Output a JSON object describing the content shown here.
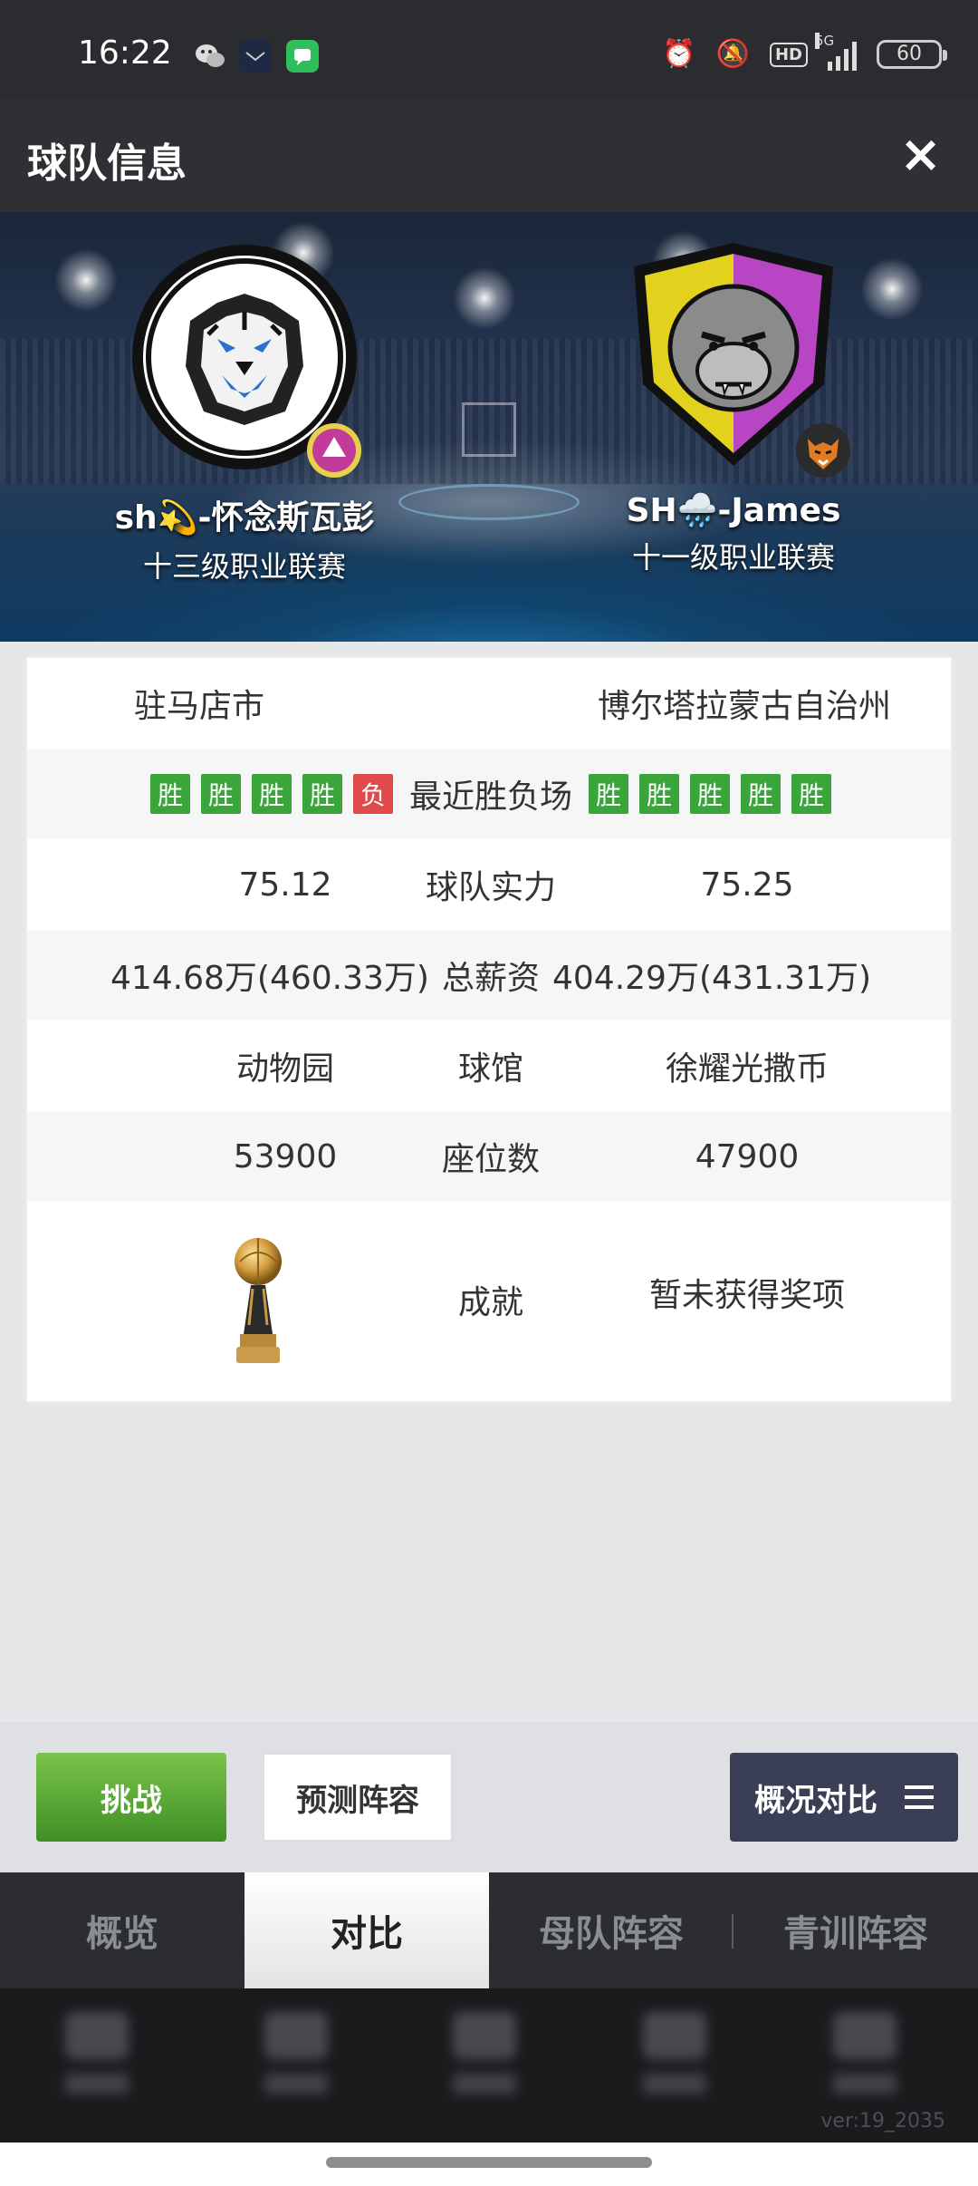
{
  "status_bar": {
    "time": "16:22",
    "network": "5G",
    "hd": "HD",
    "battery": "60"
  },
  "header": {
    "title": "球队信息",
    "close_icon": "×"
  },
  "home_team": {
    "name": "sh💫-怀念斯瓦彭",
    "league": "十三级职业联赛",
    "city": "驻马店市",
    "recent": [
      "胜",
      "胜",
      "胜",
      "胜",
      "负"
    ],
    "strength": "75.12",
    "salary": "414.68万(460.33万)",
    "arena": "动物园",
    "seats": "53900"
  },
  "away_team": {
    "name": "SH🌧️-James",
    "league": "十一级职业联赛",
    "city": "博尔塔拉蒙古自治州",
    "recent": [
      "胜",
      "胜",
      "胜",
      "胜",
      "胜"
    ],
    "strength": "75.25",
    "salary": "404.29万(431.31万)",
    "arena": "徐耀光撒币",
    "seats": "47900",
    "achievement": "暂未获得奖项"
  },
  "labels": {
    "recent": "最近胜负场",
    "strength": "球队实力",
    "salary": "总薪资",
    "arena": "球馆",
    "seats": "座位数",
    "achievement": "成就"
  },
  "actions": {
    "challenge": "挑战",
    "predict": "预测阵容",
    "compare": "概况对比"
  },
  "tabs": [
    "概览",
    "对比",
    "母队阵容",
    "青训阵容"
  ],
  "active_tab": 1,
  "version": "ver:19_2035",
  "colors": {
    "win": "#3aa53a",
    "loss": "#e04a4a",
    "accent_green": "#5aab36",
    "compare_button": "#3a3f55"
  }
}
